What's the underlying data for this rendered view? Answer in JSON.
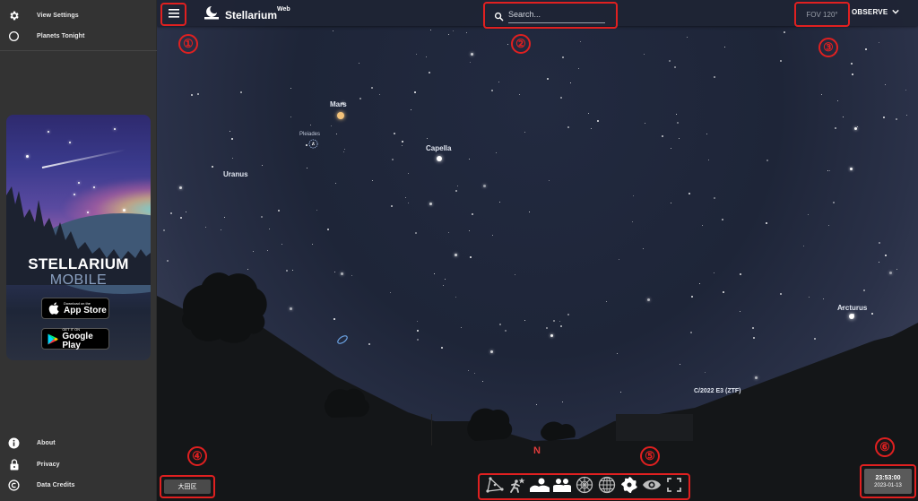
{
  "sidebar": {
    "top_items": [
      {
        "label": "View Settings",
        "icon": "gear-icon"
      },
      {
        "label": "Planets Tonight",
        "icon": "circle-icon"
      }
    ],
    "promo": {
      "title_line1": "STELLARIUM",
      "title_line2": "MOBILE",
      "app_store": {
        "small": "Download on the",
        "big": "App Store"
      },
      "google_play": {
        "small": "GET IT ON",
        "big": "Google Play"
      }
    },
    "bottom_items": [
      {
        "label": "About",
        "icon": "info-icon"
      },
      {
        "label": "Privacy",
        "icon": "lock-icon"
      },
      {
        "label": "Data Credits",
        "icon": "copyright-icon"
      }
    ]
  },
  "topbar": {
    "app_name": "Stellarium",
    "app_name_sup": "Web",
    "search_placeholder": "Search...",
    "fov": "FOV 120°",
    "observe_label": "OBSERVE"
  },
  "annotations": [
    "①",
    "②",
    "③",
    "④",
    "⑤",
    "⑥"
  ],
  "sky_labels": {
    "mars": "Mars",
    "pleiades": "Pleiades",
    "capella": "Capella",
    "uranus": "Uranus",
    "arcturus": "Arcturus",
    "comet": "C/2022 E3 (ZTF)",
    "north": "N"
  },
  "bottombar": {
    "location": "大田区",
    "toolbar_icons": [
      "constellation-lines-icon",
      "constellation-art-icon",
      "landscape-icon",
      "atmosphere-icon",
      "azimuthal-grid-icon",
      "equatorial-grid-icon",
      "deep-sky-objects-icon",
      "night-mode-eye-icon",
      "fullscreen-icon"
    ],
    "time": "23:53:00",
    "date": "2023-01-13"
  },
  "colors": {
    "annotation_red": "#e02020",
    "sidebar_bg": "#333333",
    "sky_bg": "#1e2538",
    "north_marker": "#e03c3c"
  }
}
